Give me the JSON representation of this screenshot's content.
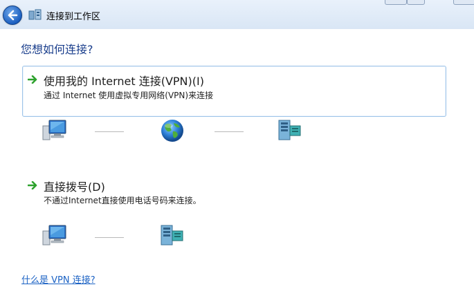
{
  "window": {
    "title": "连接到工作区"
  },
  "main": {
    "question": "您想如何连接?",
    "options": [
      {
        "title": "使用我的 Internet 连接(VPN)(I)",
        "description": "通过 Internet 使用虚拟专用网络(VPN)来连接"
      },
      {
        "title": "直接拨号(D)",
        "description": "不通过Internet直接使用电话号码来连接。"
      }
    ],
    "help_link": "什么是 VPN 连接?"
  },
  "icons": {
    "back": "back-arrow-icon",
    "network": "network-connection-icon",
    "computer": "computer-icon",
    "internet": "globe-icon",
    "workplace": "server-icon",
    "option_arrow": "green-arrow-icon"
  },
  "colors": {
    "accent": "#1a3e8c",
    "link": "#1b62c4",
    "option_border": "#9fc4e8",
    "arrow_green": "#2ea22e"
  }
}
